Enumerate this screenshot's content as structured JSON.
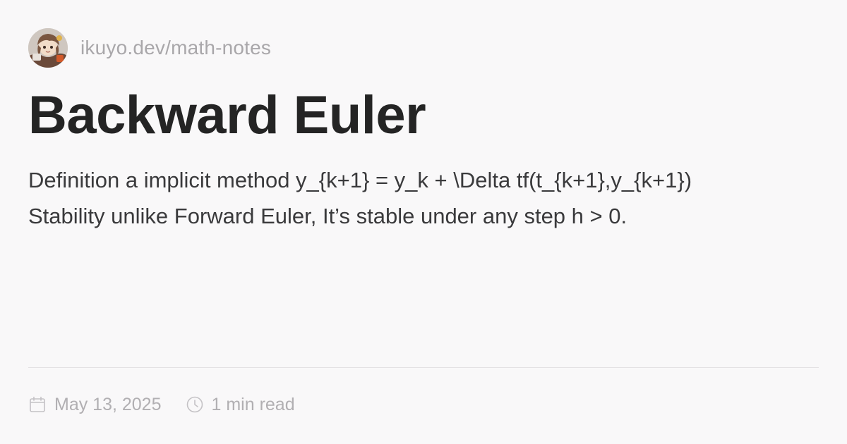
{
  "site": {
    "url": "ikuyo.dev/math-notes",
    "avatar_icon": "anime-character-avatar"
  },
  "post": {
    "title": "Backward Euler",
    "description_lines": [
      "Definition a implicit method y_{k+1} = y_k + \\Delta tf(t_{k+1},y_{k+1})",
      "Stability unlike Forward Euler, It’s stable under any step h > 0."
    ]
  },
  "meta": {
    "date": "May 13, 2025",
    "date_icon": "calendar-icon",
    "read_time": "1 min read",
    "read_time_icon": "clock-icon"
  },
  "colors": {
    "background": "#f9f8f9",
    "title": "#242424",
    "text": "#3a3a3c",
    "muted": "#b1afb2",
    "divider": "#e4e2e4"
  }
}
